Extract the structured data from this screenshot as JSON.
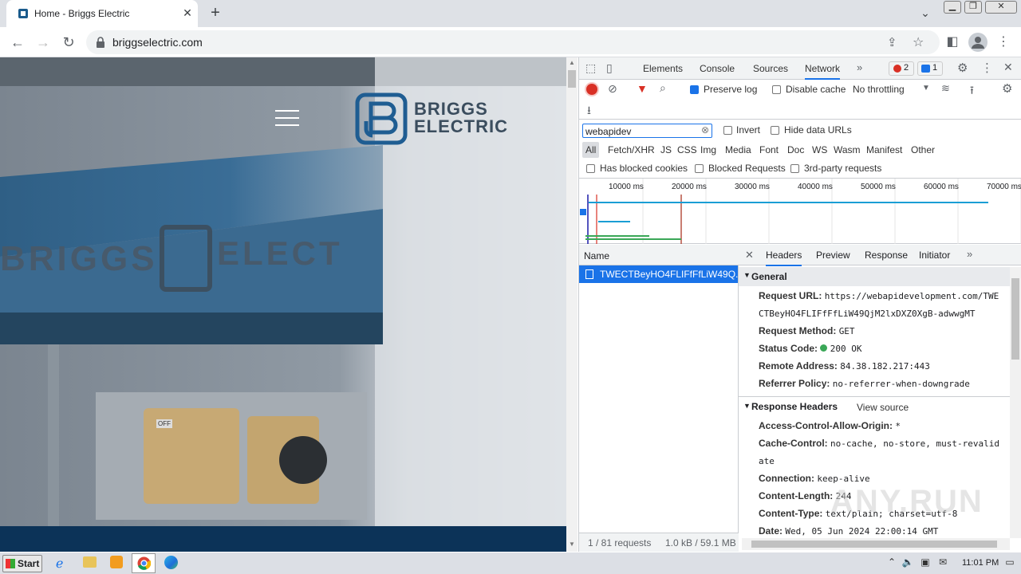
{
  "browser": {
    "tab_title": "Home - Briggs Electric",
    "url": "briggselectric.com"
  },
  "site": {
    "logo_line1": "BRIGGS",
    "logo_line2": "ELECTRIC",
    "sign_text": "BRIGGS",
    "sign_text2": "ELECT",
    "socket_label": "OFF"
  },
  "devtools": {
    "tabs": [
      "Elements",
      "Console",
      "Sources",
      "Network"
    ],
    "active_tab": "Network",
    "errors": "2",
    "messages": "1",
    "preserve_log": "Preserve log",
    "disable_cache": "Disable cache",
    "throttling": "No throttling",
    "filter_value": "webapidev",
    "invert": "Invert",
    "hide_data_urls": "Hide data URLs",
    "filter_types": [
      "All",
      "Fetch/XHR",
      "JS",
      "CSS",
      "Img",
      "Media",
      "Font",
      "Doc",
      "WS",
      "Wasm",
      "Manifest",
      "Other"
    ],
    "has_blocked_cookies": "Has blocked cookies",
    "blocked_requests": "Blocked Requests",
    "third_party": "3rd-party requests",
    "timeline_ticks": [
      "10000 ms",
      "20000 ms",
      "30000 ms",
      "40000 ms",
      "50000 ms",
      "60000 ms",
      "70000 ms"
    ],
    "name_header": "Name",
    "request_name": "TWECTBeyHO4FLIFfFfLiW49Q...",
    "status_requests": "1 / 81 requests",
    "status_size": "1.0 kB / 59.1 MB",
    "detail_tabs": [
      "Headers",
      "Preview",
      "Response",
      "Initiator"
    ],
    "general_title": "General",
    "general": [
      {
        "k": "Request URL:",
        "v": "https://webapidevelopment.com/TWE"
      },
      {
        "k": "",
        "v": "CTBeyHO4FLIFfFfLiW49QjM2lxDXZ0XgB-adwwgMT"
      },
      {
        "k": "Request Method:",
        "v": "GET"
      },
      {
        "k": "Status Code:",
        "v": "200 OK"
      },
      {
        "k": "Remote Address:",
        "v": "84.38.182.217:443"
      },
      {
        "k": "Referrer Policy:",
        "v": "no-referrer-when-downgrade"
      }
    ],
    "response_title": "Response Headers",
    "view_source": "View source",
    "response": [
      {
        "k": "Access-Control-Allow-Origin:",
        "v": "*"
      },
      {
        "k": "Cache-Control:",
        "v": "no-cache, no-store, must-revalid"
      },
      {
        "k": "",
        "v": "ate"
      },
      {
        "k": "Connection:",
        "v": "keep-alive"
      },
      {
        "k": "Content-Length:",
        "v": "244"
      },
      {
        "k": "Content-Type:",
        "v": "text/plain; charset=utf-8"
      },
      {
        "k": "Date:",
        "v": "Wed, 05 Jun 2024 22:00:14 GMT"
      }
    ]
  },
  "taskbar": {
    "start": "Start",
    "clock": "11:01 PM"
  },
  "watermark": "ANY.RUN"
}
